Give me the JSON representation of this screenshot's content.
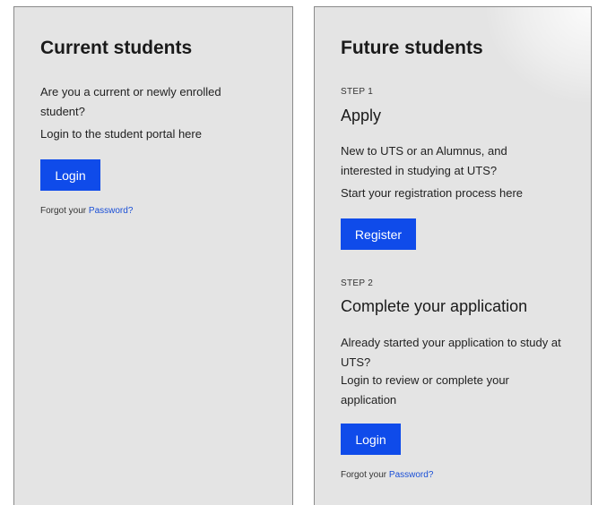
{
  "current": {
    "title": "Current students",
    "question": "Are you a current or newly enrolled student?",
    "portal_text": "Login to the student portal here",
    "login_label": "Login",
    "forgot_prefix": "Forgot your",
    "forgot_link": "Password?"
  },
  "future": {
    "title": "Future students",
    "step1": {
      "label": "STEP 1",
      "title": "Apply",
      "text": "New to UTS or an Alumnus, and interested in studying at UTS?",
      "cta_text": "Start your registration process here",
      "button_label": "Register"
    },
    "step2": {
      "label": "STEP 2",
      "title": "Complete your application",
      "text": "Already started your application to study at UTS?",
      "cta_text": "Login to review or complete your application",
      "button_label": "Login"
    },
    "forgot_prefix": "Forgot your",
    "forgot_link": "Password?"
  },
  "colors": {
    "button": "#0f4bea",
    "link": "#1a4fd6",
    "panel_bg": "#e4e4e4"
  }
}
